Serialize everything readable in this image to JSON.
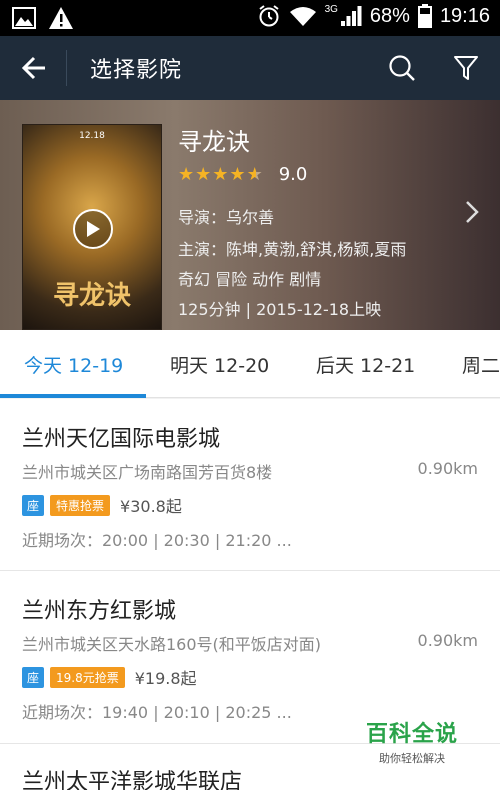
{
  "status_bar": {
    "network": "3G",
    "battery": "68%",
    "time": "19:16"
  },
  "app_bar": {
    "title": "选择影院"
  },
  "movie": {
    "title": "寻龙诀",
    "rating": "9.0",
    "stars": 4.5,
    "director": "导演：乌尔善",
    "cast": "主演：陈坤,黄渤,舒淇,杨颖,夏雨",
    "genres": "奇幻 冒险 动作 剧情",
    "runtime_release": "125分钟 | 2015-12-18上映",
    "poster_text": "寻龙诀",
    "poster_top_text": "12.18"
  },
  "date_tabs": [
    {
      "label": "今天 12-19",
      "active": true
    },
    {
      "label": "明天 12-20",
      "active": false
    },
    {
      "label": "后天 12-21",
      "active": false
    },
    {
      "label": "周二",
      "active": false
    }
  ],
  "cinemas": [
    {
      "name": "兰州天亿国际电影城",
      "address": "兰州市城关区广场南路国芳百货8楼",
      "distance": "0.90km",
      "seat_tag": "座",
      "promo_tag": "特惠抢票",
      "price": "¥30.8起",
      "showtimes": "近期场次：20:00 | 20:30 | 21:20 ..."
    },
    {
      "name": "兰州东方红影城",
      "address": "兰州市城关区天水路160号(和平饭店对面)",
      "distance": "0.90km",
      "seat_tag": "座",
      "promo_tag": "19.8元抢票",
      "price": "¥19.8起",
      "showtimes": "近期场次：19:40 | 20:10 | 20:25 ..."
    },
    {
      "name": "兰州太平洋影城华联店"
    }
  ],
  "watermark": {
    "main": "百科全说",
    "sub": "助你轻松解决"
  },
  "colors": {
    "accent": "#1e88d8",
    "app_bar": "#1f2c3a",
    "star": "#f5b324",
    "promo": "#f39a1e"
  }
}
